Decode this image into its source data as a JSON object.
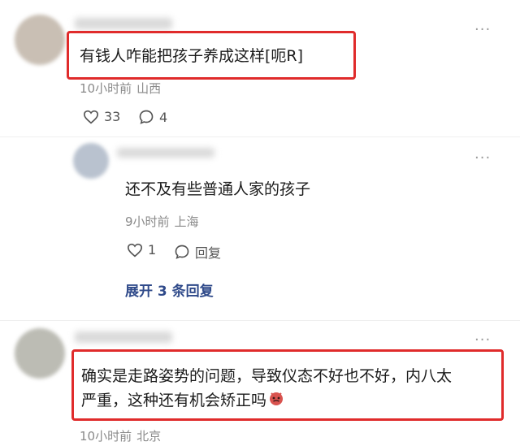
{
  "comment1": {
    "text": "有钱人咋能把孩子养成这样[呃R]",
    "time": "10小时前",
    "location": "山西",
    "likes": "33",
    "replies": "4",
    "more": "···"
  },
  "reply1": {
    "text": "还不及有些普通人家的孩子",
    "time": "9小时前",
    "location": "上海",
    "likes": "1",
    "reply_label": "回复",
    "more": "···"
  },
  "expand": {
    "label": "展开 3 条回复"
  },
  "comment2": {
    "line1": "确实是走路姿势的问题，导致仪态不好也不好，内八太",
    "line2": "严重，这种还有机会矫正吗",
    "time": "10小时前",
    "location": "北京",
    "more": "···"
  },
  "colors": {
    "highlight": "#e02b2b",
    "link": "#2f4a8a"
  }
}
